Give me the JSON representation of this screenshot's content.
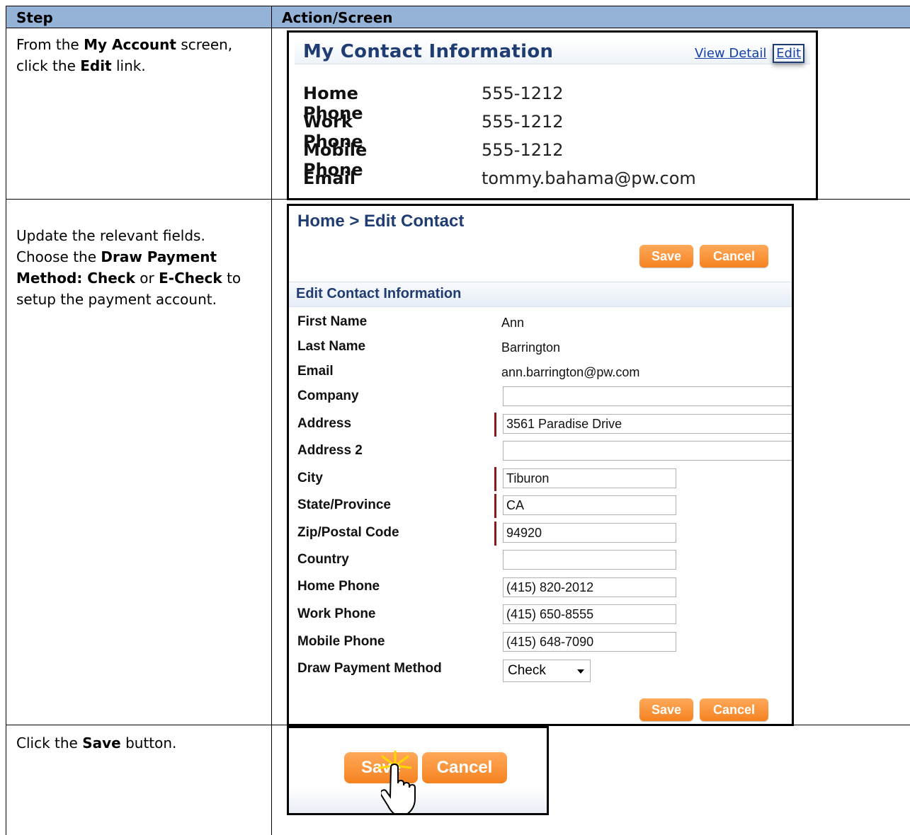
{
  "table": {
    "header": {
      "step": "Step",
      "action": "Action/Screen"
    }
  },
  "steps": [
    {
      "parts": [
        {
          "t": "From the "
        },
        {
          "t": "My Account",
          "b": true
        },
        {
          "t": " screen, click the "
        },
        {
          "t": "Edit",
          "b": true
        },
        {
          "t": " link."
        }
      ]
    },
    {
      "parts": [
        {
          "t": "Update the relevant fields. Choose the "
        },
        {
          "t": "Draw Payment Method: Check",
          "b": true
        },
        {
          "t": " or "
        },
        {
          "t": "E-Check",
          "b": true
        },
        {
          "t": " to setup the payment account."
        }
      ]
    },
    {
      "parts": [
        {
          "t": "Click the "
        },
        {
          "t": "Save",
          "b": true
        },
        {
          "t": " button."
        }
      ]
    }
  ],
  "shot1": {
    "title": "My Contact Information",
    "view_detail": "View Detail",
    "edit": "Edit",
    "rows": [
      {
        "label": "Home Phone",
        "value": "555-1212"
      },
      {
        "label": "Work Phone",
        "value": "555-1212"
      },
      {
        "label": "Mobile Phone",
        "value": "555-1212"
      },
      {
        "label": "Email",
        "value": "tommy.bahama@pw.com"
      }
    ]
  },
  "shot2": {
    "breadcrumb": "Home > Edit Contact",
    "save": "Save",
    "cancel": "Cancel",
    "section_title": "Edit Contact Information",
    "fields": {
      "first_name": {
        "label": "First Name",
        "value": "Ann"
      },
      "last_name": {
        "label": "Last Name",
        "value": "Barrington"
      },
      "email": {
        "label": "Email",
        "value": "ann.barrington@pw.com"
      },
      "company": {
        "label": "Company",
        "value": ""
      },
      "address": {
        "label": "Address",
        "value": "3561 Paradise Drive"
      },
      "address2": {
        "label": "Address 2",
        "value": ""
      },
      "city": {
        "label": "City",
        "value": "Tiburon"
      },
      "state": {
        "label": "State/Province",
        "value": "CA"
      },
      "zip": {
        "label": "Zip/Postal Code",
        "value": "94920"
      },
      "country": {
        "label": "Country",
        "value": ""
      },
      "home_phone": {
        "label": "Home Phone",
        "value": "(415) 820-2012"
      },
      "work_phone": {
        "label": "Work Phone",
        "value": "(415) 650-8555"
      },
      "mobile_phone": {
        "label": "Mobile Phone",
        "value": "(415) 648-7090"
      },
      "draw_payment": {
        "label": "Draw Payment Method",
        "value": "Check"
      }
    }
  },
  "shot3": {
    "save": "Save",
    "cancel": "Cancel"
  },
  "colors": {
    "header_bg": "#95b3d7",
    "button_orange": "#f58220",
    "title_blue": "#1f3d73",
    "required_marker": "#8b1a1a"
  }
}
